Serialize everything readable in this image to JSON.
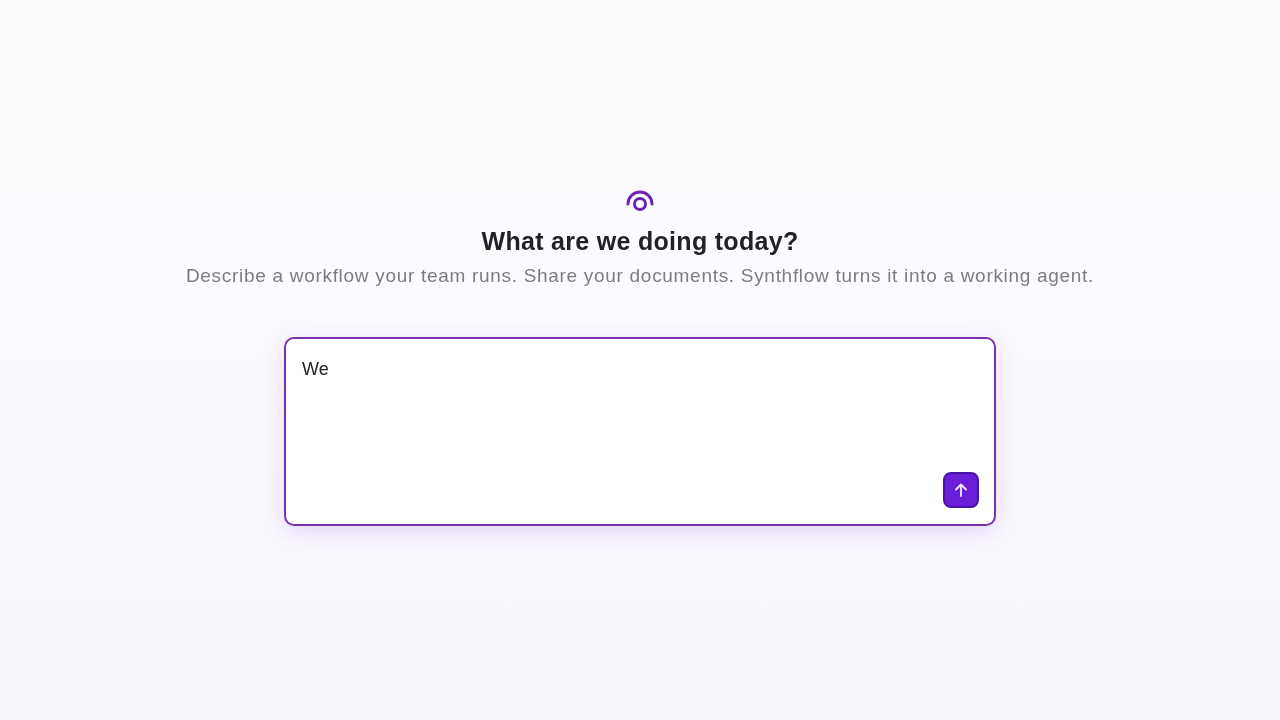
{
  "hero": {
    "heading": "What are we doing today?",
    "subtitle": "Describe a workflow your team runs. Share your documents. Synthflow turns it into a working agent."
  },
  "composer": {
    "value": "We",
    "focused": true,
    "send_button": {
      "disabled": false
    }
  }
}
